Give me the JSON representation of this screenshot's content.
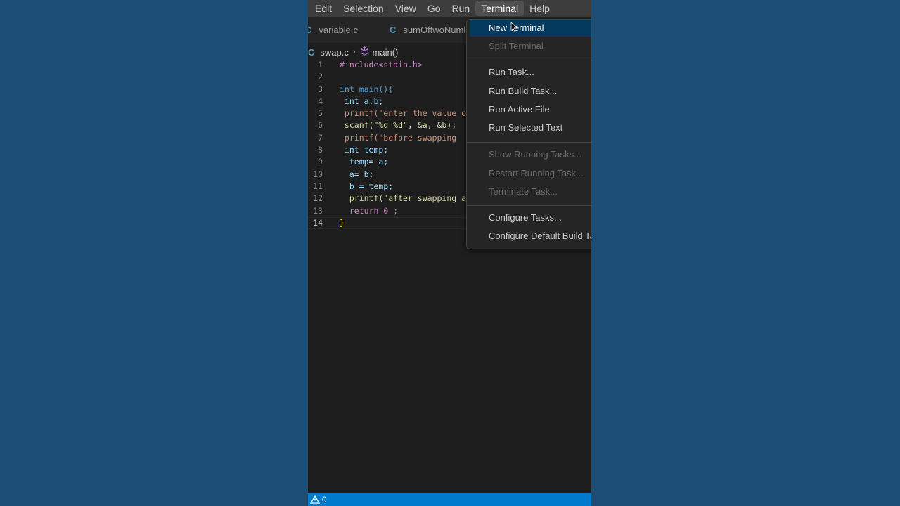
{
  "menubar": {
    "items": [
      "Edit",
      "Selection",
      "View",
      "Go",
      "Run",
      "Terminal",
      "Help"
    ],
    "active": "Terminal"
  },
  "tabs": [
    {
      "label": "variable.c",
      "icon": "c-file-icon"
    },
    {
      "label": "sumOftwoNuml",
      "icon": "c-file-icon"
    }
  ],
  "breadcrumb": {
    "file": "swap.c",
    "symbol": "main()"
  },
  "editor": {
    "active_line": 14,
    "lines": [
      {
        "n": "1",
        "text": "#include<stdio.h>"
      },
      {
        "n": "2",
        "text": ""
      },
      {
        "n": "3",
        "text": "int main(){"
      },
      {
        "n": "4",
        "text": " int a,b;"
      },
      {
        "n": "5",
        "text": " printf(\"enter the value o"
      },
      {
        "n": "6",
        "text": " scanf(\"%d %d\", &a, &b);"
      },
      {
        "n": "7",
        "text": " printf(\"before swapping"
      },
      {
        "n": "8",
        "text": " int temp;"
      },
      {
        "n": "9",
        "text": "  temp= a;"
      },
      {
        "n": "10",
        "text": "  a= b;"
      },
      {
        "n": "11",
        "text": "  b = temp;"
      },
      {
        "n": "12",
        "text": "  printf(\"after swapping a"
      },
      {
        "n": "13",
        "text": "  return 0 ;"
      },
      {
        "n": "14",
        "text": "}"
      }
    ]
  },
  "terminal_menu": {
    "groups": [
      [
        {
          "label": "New Terminal",
          "state": "selected"
        },
        {
          "label": "Split Terminal",
          "state": "disabled"
        }
      ],
      [
        {
          "label": "Run Task...",
          "state": "normal"
        },
        {
          "label": "Run Build Task...",
          "state": "normal"
        },
        {
          "label": "Run Active File",
          "state": "normal"
        },
        {
          "label": "Run Selected Text",
          "state": "normal"
        }
      ],
      [
        {
          "label": "Show Running Tasks...",
          "state": "disabled"
        },
        {
          "label": "Restart Running Task...",
          "state": "disabled"
        },
        {
          "label": "Terminate Task...",
          "state": "disabled"
        }
      ],
      [
        {
          "label": "Configure Tasks...",
          "state": "normal"
        },
        {
          "label": "Configure Default Build Ta",
          "state": "normal"
        }
      ]
    ]
  },
  "statusbar": {
    "warnings": "0"
  },
  "colors": {
    "background": "#1b4d75",
    "statusbar": "#007acc",
    "menu_selected": "#04395e",
    "c_icon": "#519aba"
  }
}
